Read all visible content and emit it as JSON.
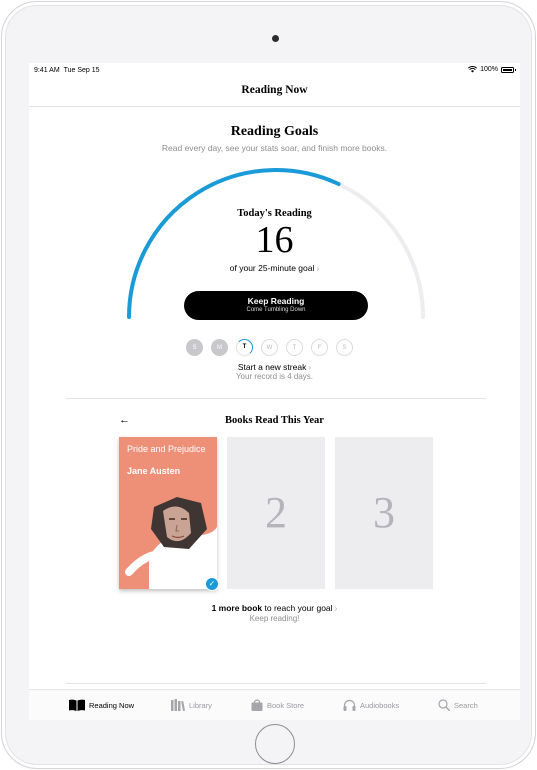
{
  "status_bar": {
    "time": "9:41 AM",
    "date": "Tue Sep 15",
    "battery": "100%"
  },
  "nav": {
    "title": "Reading Now"
  },
  "reading_goals": {
    "title": "Reading Goals",
    "subtitle": "Read every day, see your stats soar, and finish more books.",
    "today_label": "Today's Reading",
    "today_minutes": "16",
    "goal_text": "of your 25-minute goal",
    "goal_chevron": "›",
    "progress_fraction": 0.64,
    "accent_color": "#1a9bd7",
    "keep_reading": {
      "label": "Keep Reading",
      "subtitle": "Come Tumbling Down"
    },
    "days": [
      "S",
      "M",
      "T",
      "W",
      "T",
      "F",
      "S"
    ],
    "streak_title": "Start a new streak",
    "streak_chevron": "›",
    "streak_sub": "Your record is 4 days."
  },
  "books_read": {
    "back_arrow": "←",
    "title": "Books Read This Year",
    "book": {
      "title": "Pride and Prejudice",
      "author": "Jane Austen",
      "cover_color": "#ee8f78"
    },
    "check": "✓",
    "slot_2": "2",
    "slot_3": "3",
    "more_bold": "1 more book",
    "more_rest": " to reach your goal",
    "more_chevron": "›",
    "sub": "Keep reading!"
  },
  "tabs": [
    {
      "label": "Reading Now",
      "icon": "book-open-icon"
    },
    {
      "label": "Library",
      "icon": "library-icon"
    },
    {
      "label": "Book Store",
      "icon": "bag-icon"
    },
    {
      "label": "Audiobooks",
      "icon": "headphones-icon"
    },
    {
      "label": "Search",
      "icon": "search-icon"
    }
  ]
}
